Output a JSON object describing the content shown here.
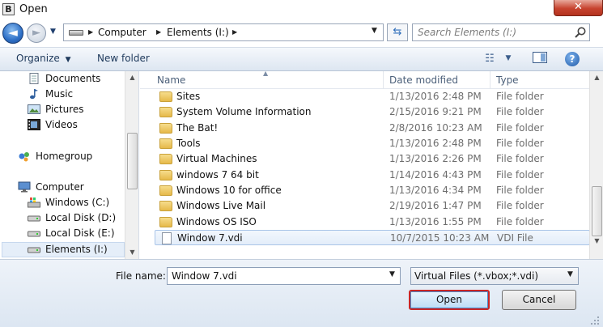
{
  "window": {
    "title": "Open",
    "app_icon_letter": "B",
    "close_label": "✕"
  },
  "address": {
    "crumbs": [
      "Computer",
      "Elements (I:)"
    ],
    "search_placeholder": "Search Elements (I:)"
  },
  "toolbar": {
    "organize_label": "Organize",
    "new_folder_label": "New folder"
  },
  "nav": {
    "items": [
      {
        "label": "Documents",
        "icon": "documents-icon"
      },
      {
        "label": "Music",
        "icon": "music-icon"
      },
      {
        "label": "Pictures",
        "icon": "pictures-icon"
      },
      {
        "label": "Videos",
        "icon": "videos-icon"
      },
      {
        "label": "Homegroup",
        "icon": "homegroup-icon"
      },
      {
        "label": "Computer",
        "icon": "computer-icon"
      },
      {
        "label": "Windows (C:)",
        "icon": "windows-drive-icon"
      },
      {
        "label": "Local Disk (D:)",
        "icon": "drive-icon"
      },
      {
        "label": "Local Disk (E:)",
        "icon": "drive-icon"
      },
      {
        "label": "Elements (I:)",
        "icon": "drive-icon"
      }
    ]
  },
  "files": {
    "columns": {
      "name": "Name",
      "date": "Date modified",
      "type": "Type"
    },
    "rows": [
      {
        "name": "Sites",
        "date": "1/13/2016 2:48 PM",
        "type": "File folder",
        "icon": "folder-icon"
      },
      {
        "name": "System Volume Information",
        "date": "2/15/2016 9:21 PM",
        "type": "File folder",
        "icon": "folder-icon"
      },
      {
        "name": "The Bat!",
        "date": "2/8/2016 10:23 AM",
        "type": "File folder",
        "icon": "folder-icon"
      },
      {
        "name": "Tools",
        "date": "1/13/2016 2:48 PM",
        "type": "File folder",
        "icon": "folder-icon"
      },
      {
        "name": "Virtual Machines",
        "date": "1/13/2016 2:26 PM",
        "type": "File folder",
        "icon": "folder-icon"
      },
      {
        "name": "windows 7 64 bit",
        "date": "1/14/2016 4:43 PM",
        "type": "File folder",
        "icon": "folder-icon"
      },
      {
        "name": "Windows 10 for office",
        "date": "1/13/2016 4:34 PM",
        "type": "File folder",
        "icon": "folder-icon"
      },
      {
        "name": "Windows Live Mail",
        "date": "2/19/2016 1:47 PM",
        "type": "File folder",
        "icon": "folder-icon"
      },
      {
        "name": "Windows OS ISO",
        "date": "1/13/2016 1:55 PM",
        "type": "File folder",
        "icon": "folder-icon"
      },
      {
        "name": "Window 7.vdi",
        "date": "10/7/2015 10:23 AM",
        "type": "VDI File",
        "icon": "file-icon"
      }
    ]
  },
  "bottom": {
    "file_name_label": "File name:",
    "file_name_value": "Window 7.vdi",
    "file_type_value": "Virtual Files (*.vbox;*.vdi)",
    "open_label": "Open",
    "cancel_label": "Cancel"
  }
}
